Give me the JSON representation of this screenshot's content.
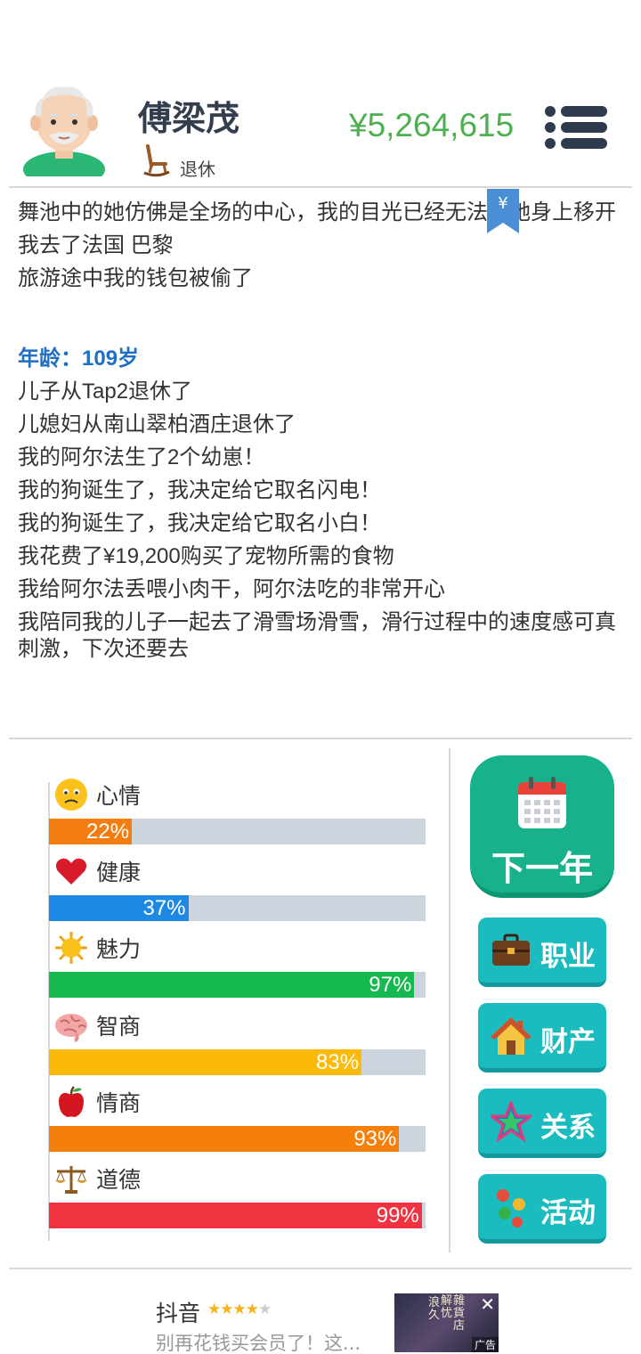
{
  "header": {
    "name": "傅梁茂",
    "status": "退休",
    "money": "¥5,264,615",
    "bookmark_symbol": "¥"
  },
  "log_top": [
    "舞池中的她仿佛是全场的中心，我的目光已经无法从她身上移开",
    "我去了法国 巴黎",
    "旅游途中我的钱包被偷了"
  ],
  "log_age": "年龄：109岁",
  "log_bottom": [
    "儿子从Tap2退休了",
    "儿媳妇从南山翠柏酒庄退休了",
    "我的阿尔法生了2个幼崽！",
    "我的狗诞生了，我决定给它取名闪电！",
    "我的狗诞生了，我决定给它取名小白！",
    "我花费了¥19,200购买了宠物所需的食物",
    "我给阿尔法丢喂小肉干，阿尔法吃的非常开心",
    "我陪同我的儿子一起去了滑雪场滑雪，滑行过程中的速度感可真刺激，下次还要去"
  ],
  "stats": [
    {
      "label": "心情",
      "icon": "worried-face-icon",
      "value": 22,
      "pct_text": "22%",
      "color": "#f47d12"
    },
    {
      "label": "健康",
      "icon": "heart-icon",
      "value": 37,
      "pct_text": "37%",
      "color": "#1e88e5"
    },
    {
      "label": "魅力",
      "icon": "sun-icon",
      "value": 97,
      "pct_text": "97%",
      "color": "#15b94f"
    },
    {
      "label": "智商",
      "icon": "brain-icon",
      "value": 83,
      "pct_text": "83%",
      "color": "#fbb90a"
    },
    {
      "label": "情商",
      "icon": "apple-icon",
      "value": 93,
      "pct_text": "93%",
      "color": "#f57f0b"
    },
    {
      "label": "道德",
      "icon": "scales-icon",
      "value": 99,
      "pct_text": "99%",
      "color": "#ef3340"
    }
  ],
  "buttons": {
    "next_year": "下一年",
    "career": "职业",
    "assets": "财产",
    "relations": "关系",
    "activities": "活动"
  },
  "ad": {
    "title": "抖音",
    "rating": 4,
    "description": "别再花钱买会员了！这...",
    "thumb_text": [
      "浪",
      "久",
      "解",
      "忧",
      "雜",
      "貨",
      "店"
    ],
    "badge": "广告"
  }
}
